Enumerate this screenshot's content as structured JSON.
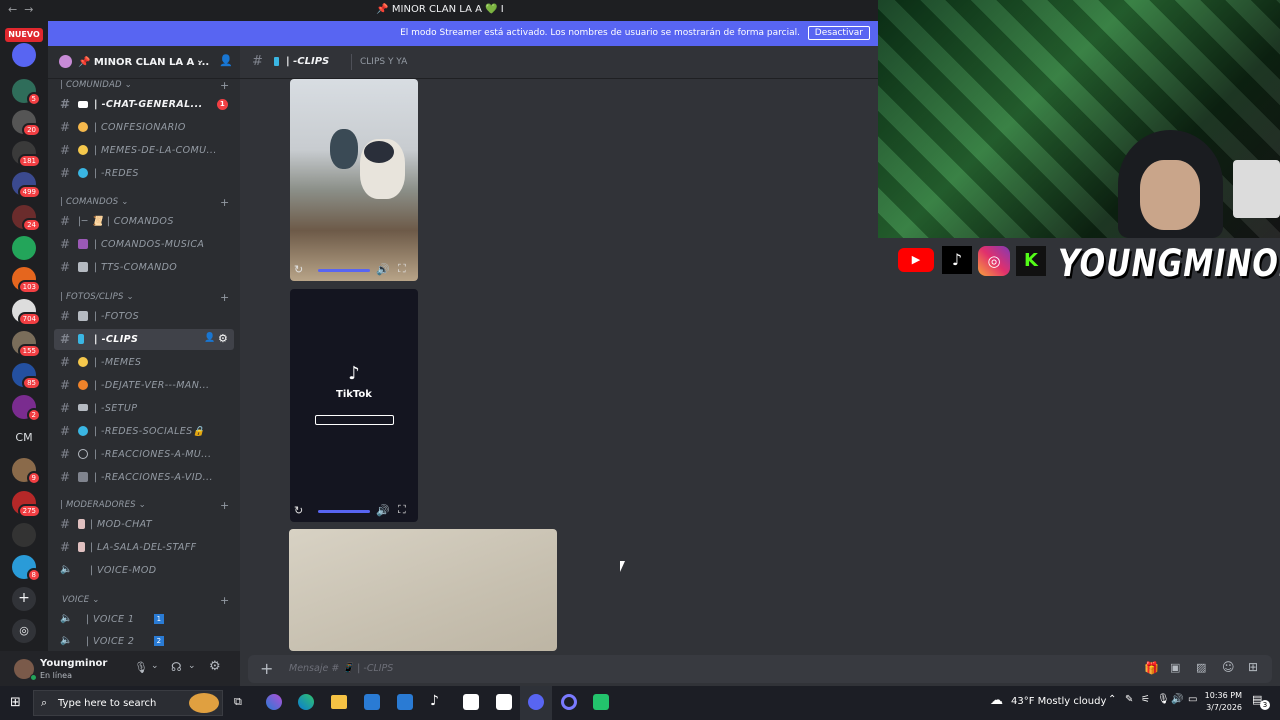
{
  "window": {
    "title": "📌 MINOR CLAN LA A 💚 I",
    "back": "←",
    "forward": "→"
  },
  "streamer_banner": {
    "message": "El modo Streamer está activado. Los nombres de usuario se mostrarán de forma parcial.",
    "button": "Desactivar"
  },
  "servers": {
    "nuevo_label": "NUEVO",
    "badges": [
      "5",
      "20",
      "181",
      "499",
      "24",
      "103",
      "704",
      "155",
      "85",
      "2",
      "9",
      "275",
      "8"
    ],
    "cm_label": "CM",
    "add_icon": "plus-icon",
    "explore_icon": "compass-icon"
  },
  "guild": {
    "name": "📌 MINOR CLAN LA A ..."
  },
  "categories": [
    {
      "name": "| COMUNIDAD ⌄"
    },
    {
      "name": "| COMANDOS ⌄"
    },
    {
      "name": "| FOTOS/CLIPS ⌄"
    },
    {
      "name": "| MODERADORES ⌄"
    },
    {
      "name": "VOICE ⌄"
    }
  ],
  "channels": [
    {
      "label": "| -CHAT-GENERAL...",
      "badge": "1"
    },
    {
      "label": "| CONFESIONARIO"
    },
    {
      "label": "| MEMES-DE-LA-COMU..."
    },
    {
      "label": "| -REDES"
    },
    {
      "label": "|─ 📜 | COMANDOS"
    },
    {
      "label": "| COMANDOS-MUSICA"
    },
    {
      "label": "| TTS-COMANDO"
    },
    {
      "label": "| -FOTOS"
    },
    {
      "label": "| -CLIPS"
    },
    {
      "label": "| -MEMES"
    },
    {
      "label": "| -DEJATE-VER---MAN..."
    },
    {
      "label": "| -SETUP"
    },
    {
      "label": "| -REDES-SOCIALES🔒"
    },
    {
      "label": "| -REACCIONES-A-MU..."
    },
    {
      "label": "| -REACCIONES-A-VID..."
    },
    {
      "label": "| MOD-CHAT"
    },
    {
      "label": "| LA-SALA-DEL-STAFF"
    },
    {
      "label": "| VOICE-MOD"
    },
    {
      "label": "| VOICE 1"
    },
    {
      "label": "| VOICE 2"
    }
  ],
  "voice_numbers": [
    "1",
    "2"
  ],
  "header": {
    "channel": "| -CLIPS",
    "topic": "CLIPS Y YA"
  },
  "tiktok": {
    "brand": "TikTok"
  },
  "composer": {
    "placeholder": "Mensaje # 📱 | -CLIPS"
  },
  "user": {
    "name": "Youngminor",
    "status": "En línea"
  },
  "overlay": {
    "brand_name": "YOUNGMINOR"
  },
  "taskbar": {
    "search_placeholder": "Type here to search",
    "weather": "43°F  Mostly cloudy",
    "time": "10:36 PM",
    "date": "3/7/2026",
    "notif_count": "3"
  },
  "colors": {
    "accent": "#5865f2",
    "unread": "#f23f43",
    "green": "#23a55a"
  }
}
